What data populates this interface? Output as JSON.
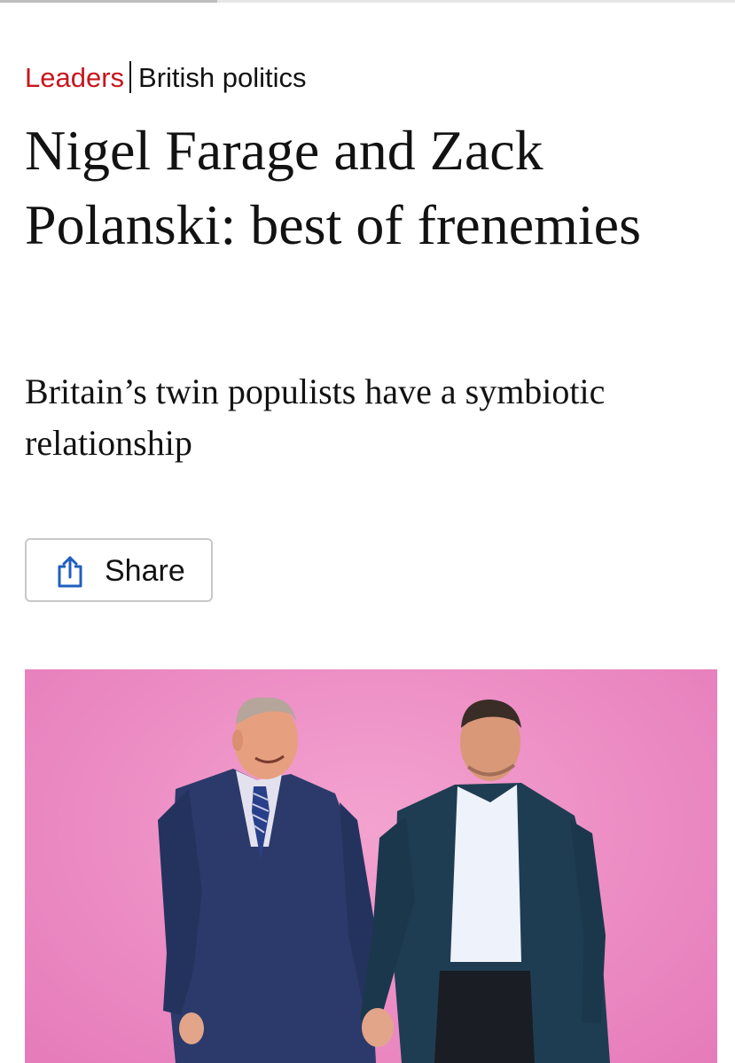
{
  "article": {
    "section": "Leaders",
    "topic": "British politics",
    "headline": "Nigel Farage and Zack Polanski: best of frenemies",
    "standfirst": "Britain’s twin populists have a symbiotic relationship",
    "share_label": "Share",
    "share_icon": "share-icon"
  },
  "colors": {
    "section_red": "#c8161d",
    "hero_pink": "#ec8cc4",
    "share_icon_blue": "#1f5fbf"
  }
}
